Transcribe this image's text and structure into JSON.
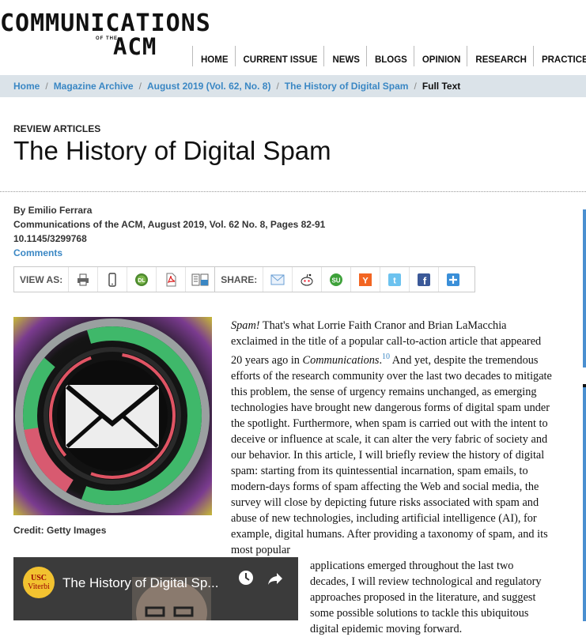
{
  "logo": {
    "main": "COMMUNICATIONS",
    "of": "OF THE",
    "acm": "ACM"
  },
  "nav": [
    "HOME",
    "CURRENT ISSUE",
    "NEWS",
    "BLOGS",
    "OPINION",
    "RESEARCH",
    "PRACTICE"
  ],
  "breadcrumb": {
    "items": [
      "Home",
      "Magazine Archive",
      "August 2019 (Vol. 62, No. 8)",
      "The History of Digital Spam"
    ],
    "current": "Full Text",
    "separator": "/"
  },
  "article": {
    "section": "REVIEW ARTICLES",
    "title": "The History of Digital Spam",
    "byline": "By Emilio Ferrara",
    "citation": "Communications of the ACM, August 2019, Vol. 62 No. 8, Pages 82-91",
    "doi": "10.1145/3299768",
    "comments": "Comments"
  },
  "toolbar": {
    "view_label": "VIEW AS:",
    "view_icons": [
      "print-icon",
      "mobile-icon",
      "digital-library-icon",
      "pdf-icon",
      "digital-edition-icon"
    ],
    "share_label": "SHARE:",
    "share_icons": [
      "email-icon",
      "reddit-icon",
      "stumbleupon-icon",
      "hacker-news-icon",
      "twitter-icon",
      "facebook-icon",
      "more-share-icon"
    ]
  },
  "image": {
    "credit": "Credit: Getty Images"
  },
  "body": {
    "p1_em": "Spam!",
    "p1_a": " That's what Lorrie Faith Cranor and Brian LaMacchia exclaimed in the title of a popular call-to-action article that appeared 20 years ago in ",
    "p1_em2": "Communications",
    "p1_dot": ".",
    "p1_ref": "10",
    "p1_b": " And yet, despite the tremendous efforts of the research community over the last two decades to mitigate this problem, the sense of urgency remains unchanged, as emerging technologies have brought new dangerous forms of digital spam under the spotlight. Furthermore, when spam is carried out with the intent to deceive or influence at scale, it can alter the very fabric of society and our behavior. In this article, I will briefly review the history of digital spam: starting from its quintessential incarnation, spam emails, to modern-days forms of spam affecting the Web and social media, the survey will close by depicting future risks associated with spam and abuse of new technologies, including artificial intelligence (AI), for example, digital humans. After providing a taxonomy of spam, and its most popular",
    "p1_c": "applications emerged throughout the last two decades, I will review technological and regulatory approaches proposed in the literature, and suggest some possible solutions to tackle this ubiquitous digital epidemic moving forward."
  },
  "video": {
    "title": "The History of Digital Sp...",
    "logo_line1": "USC",
    "logo_line2": "Viterbi"
  },
  "colors": {
    "link": "#3a87c4",
    "breadcrumb_bg": "#dbe3e9",
    "accent": "#4a8fd0"
  }
}
